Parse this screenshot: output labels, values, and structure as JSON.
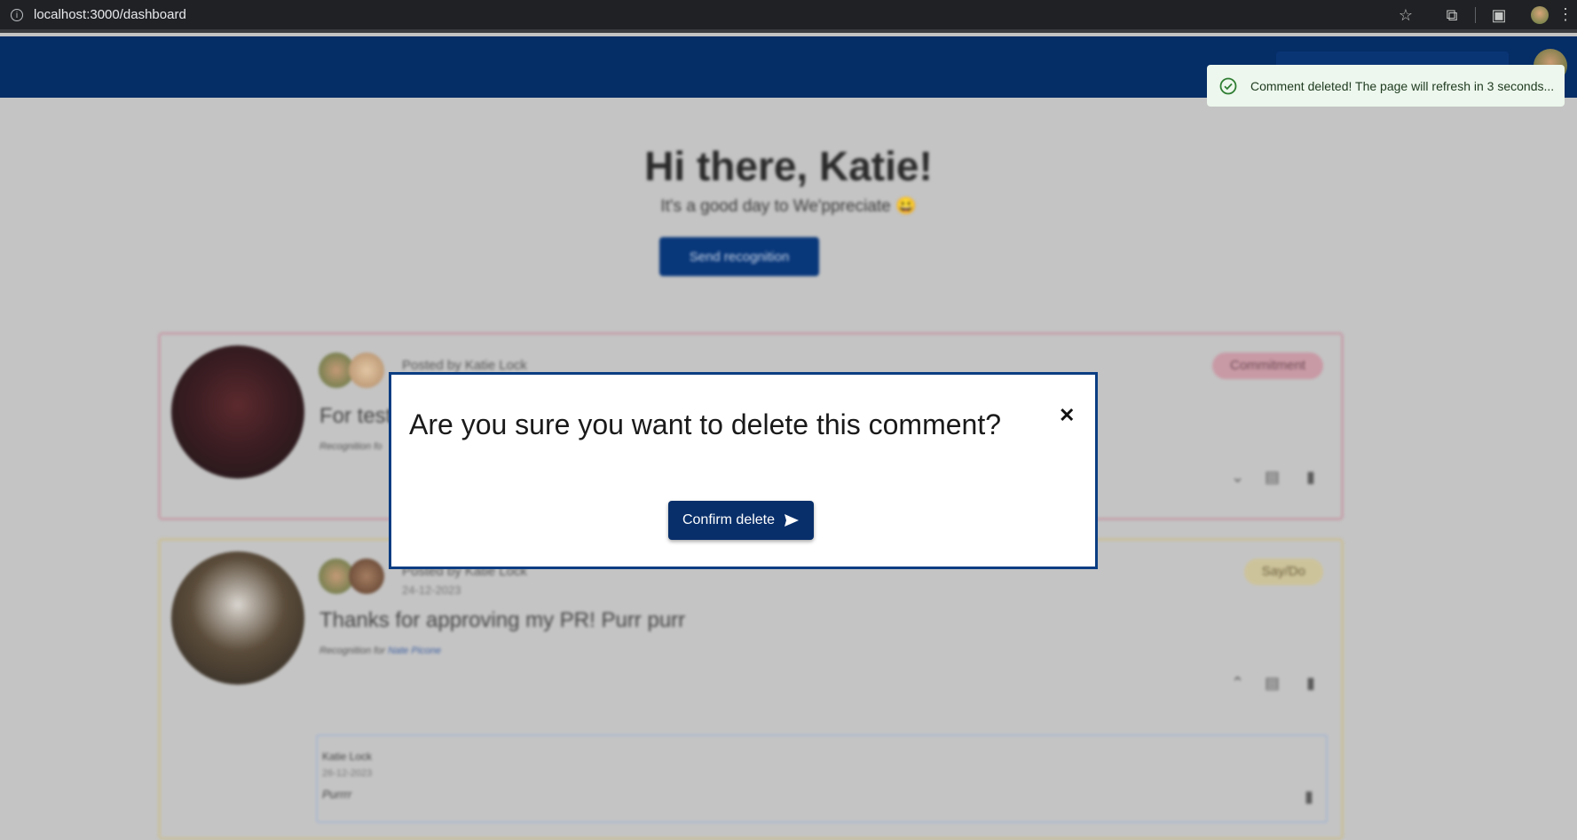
{
  "browser": {
    "url_host": "localhost",
    "url_path": ":3000/dashboard"
  },
  "dashboard": {
    "greeting": "Hi there, Katie!",
    "subtitle": "It's a good day to We'ppreciate 😀",
    "send_button": "Send recognition"
  },
  "posts": [
    {
      "posted_by": "Posted by Katie Lock",
      "message": "For test",
      "recognition_prefix": "Recognition fo",
      "badge": "Commitment"
    },
    {
      "posted_by": "Posted by Katie Lock",
      "date": "24-12-2023",
      "message": "Thanks for approving my PR! Purr purr",
      "recognition_prefix": "Recognition for",
      "recognition_name": "Nate Picone",
      "badge": "Say/Do",
      "comment": {
        "author": "Katie Lock",
        "date": "26-12-2023",
        "text": "Purrrr"
      }
    }
  ],
  "modal": {
    "title": "Are you sure you want to delete this comment?",
    "confirm_label": "Confirm delete"
  },
  "toast": {
    "message": "Comment deleted! The page will refresh in 3 seconds..."
  },
  "colors": {
    "primary": "#082f6a",
    "toast_bg": "#edf7ed",
    "toast_icon": "#2e7d32"
  }
}
